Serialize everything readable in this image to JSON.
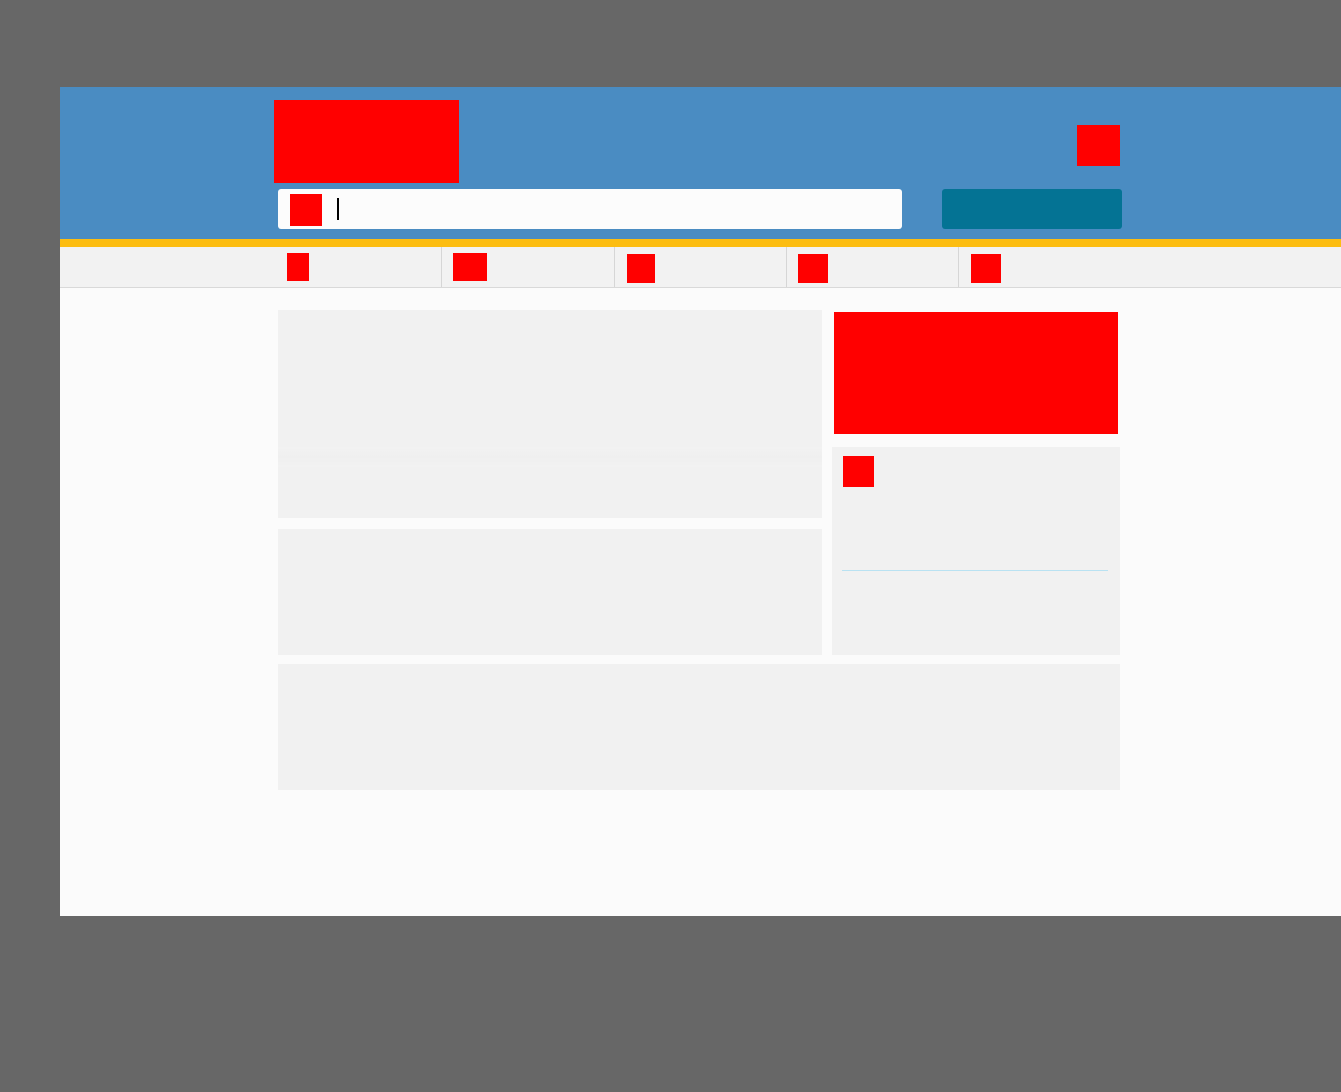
{
  "header": {
    "logo": "logo-image",
    "top_right_icon": "header-icon"
  },
  "search": {
    "icon": "search-icon",
    "value": "",
    "placeholder": "",
    "button_label": ""
  },
  "nav": {
    "items": [
      {
        "icon": "nav-icon-1",
        "label": ""
      },
      {
        "icon": "nav-icon-2",
        "label": ""
      },
      {
        "icon": "nav-icon-3",
        "label": ""
      },
      {
        "icon": "nav-icon-4",
        "label": ""
      },
      {
        "icon": "nav-icon-5",
        "label": ""
      }
    ]
  },
  "sidebar": {
    "promo": "promo-image",
    "card_icon": "card-icon"
  },
  "colors": {
    "backdrop": "#676767",
    "header": "#4a8cc2",
    "accent_stripe": "#fcbd11",
    "search_button": "#047394",
    "nav_bar": "#f2f2f2",
    "card": "#f1f1f1",
    "placeholder_block": "#ff0000",
    "divider": "#b9e2f2"
  }
}
